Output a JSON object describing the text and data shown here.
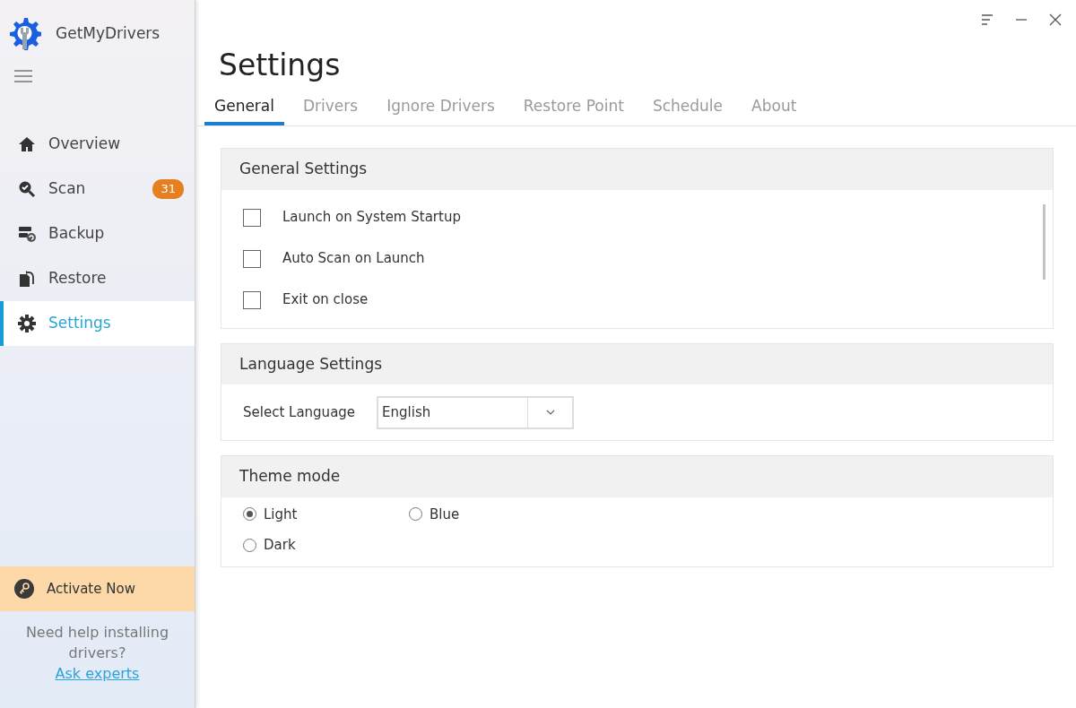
{
  "app": {
    "title": "GetMyDrivers"
  },
  "sidebar": {
    "items": [
      {
        "label": "Overview",
        "selected": false
      },
      {
        "label": "Scan",
        "selected": false,
        "badge": "31"
      },
      {
        "label": "Backup",
        "selected": false
      },
      {
        "label": "Restore",
        "selected": false
      },
      {
        "label": "Settings",
        "selected": true
      }
    ],
    "activate": "Activate Now",
    "help_text": "Need help installing drivers?",
    "help_link": "Ask experts"
  },
  "page": {
    "title": "Settings",
    "tabs": [
      {
        "label": "General",
        "selected": true
      },
      {
        "label": "Drivers",
        "selected": false
      },
      {
        "label": "Ignore Drivers",
        "selected": false
      },
      {
        "label": "Restore Point",
        "selected": false
      },
      {
        "label": "Schedule",
        "selected": false
      },
      {
        "label": "About",
        "selected": false
      }
    ],
    "general": {
      "title": "General Settings",
      "options": [
        {
          "label": "Launch on System Startup",
          "checked": false
        },
        {
          "label": "Auto Scan on Launch",
          "checked": false
        },
        {
          "label": "Exit on close",
          "checked": false
        }
      ]
    },
    "language": {
      "title": "Language Settings",
      "label": "Select Language",
      "value": "English"
    },
    "theme": {
      "title": "Theme mode",
      "options": [
        {
          "label": "Light",
          "selected": true
        },
        {
          "label": "Blue",
          "selected": false
        },
        {
          "label": "Dark",
          "selected": false
        }
      ]
    }
  }
}
